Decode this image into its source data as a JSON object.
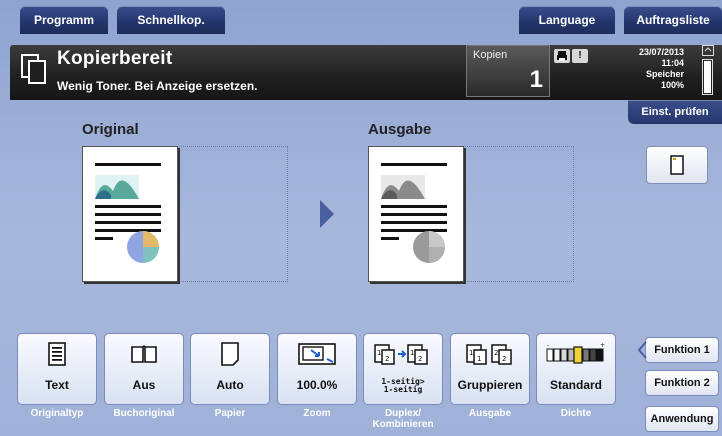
{
  "tabs": {
    "programm": "Programm",
    "schnellkop": "Schnellkop.",
    "language": "Language",
    "auftragsliste": "Auftragsliste"
  },
  "status": {
    "title": "Kopierbereit",
    "message": "Wenig Toner. Bei Anzeige ersetzen.",
    "copies_label": "Kopien",
    "copies_value": "1",
    "date": "23/07/2013",
    "time": "11:04",
    "memory_label": "Speicher",
    "memory_value": "100%",
    "memory_level": 1.0
  },
  "side": {
    "einst_pruefen": "Einst. prüfen"
  },
  "preview": {
    "original_label": "Original",
    "output_label": "Ausgabe"
  },
  "functions": [
    {
      "value": "Text",
      "caption": "Originaltyp",
      "icon": "text-document-icon"
    },
    {
      "value": "Aus",
      "caption": "Buchoriginal",
      "icon": "open-book-icon"
    },
    {
      "value": "Auto",
      "caption": "Papier",
      "icon": "paper-icon"
    },
    {
      "value": "100.0%",
      "caption": "Zoom",
      "icon": "zoom-icon"
    },
    {
      "value_line1": "1-seitig>",
      "value_line2": "1-seitig",
      "caption_line1": "Duplex/",
      "caption_line2": "Kombinieren",
      "icon": "duplex-icon"
    },
    {
      "value": "Gruppieren",
      "caption": "Ausgabe",
      "icon": "group-output-icon"
    },
    {
      "value": "Standard",
      "caption": "Dichte",
      "icon": "density-icon"
    }
  ],
  "function_keys": {
    "f1": "Funktion 1",
    "f2": "Funktion 2",
    "anwendung": "Anwendung"
  },
  "colors": {
    "tab_bg": "#23346a",
    "screen_bg": "#a8b8dc",
    "status_bg": "#1f1f1f"
  }
}
